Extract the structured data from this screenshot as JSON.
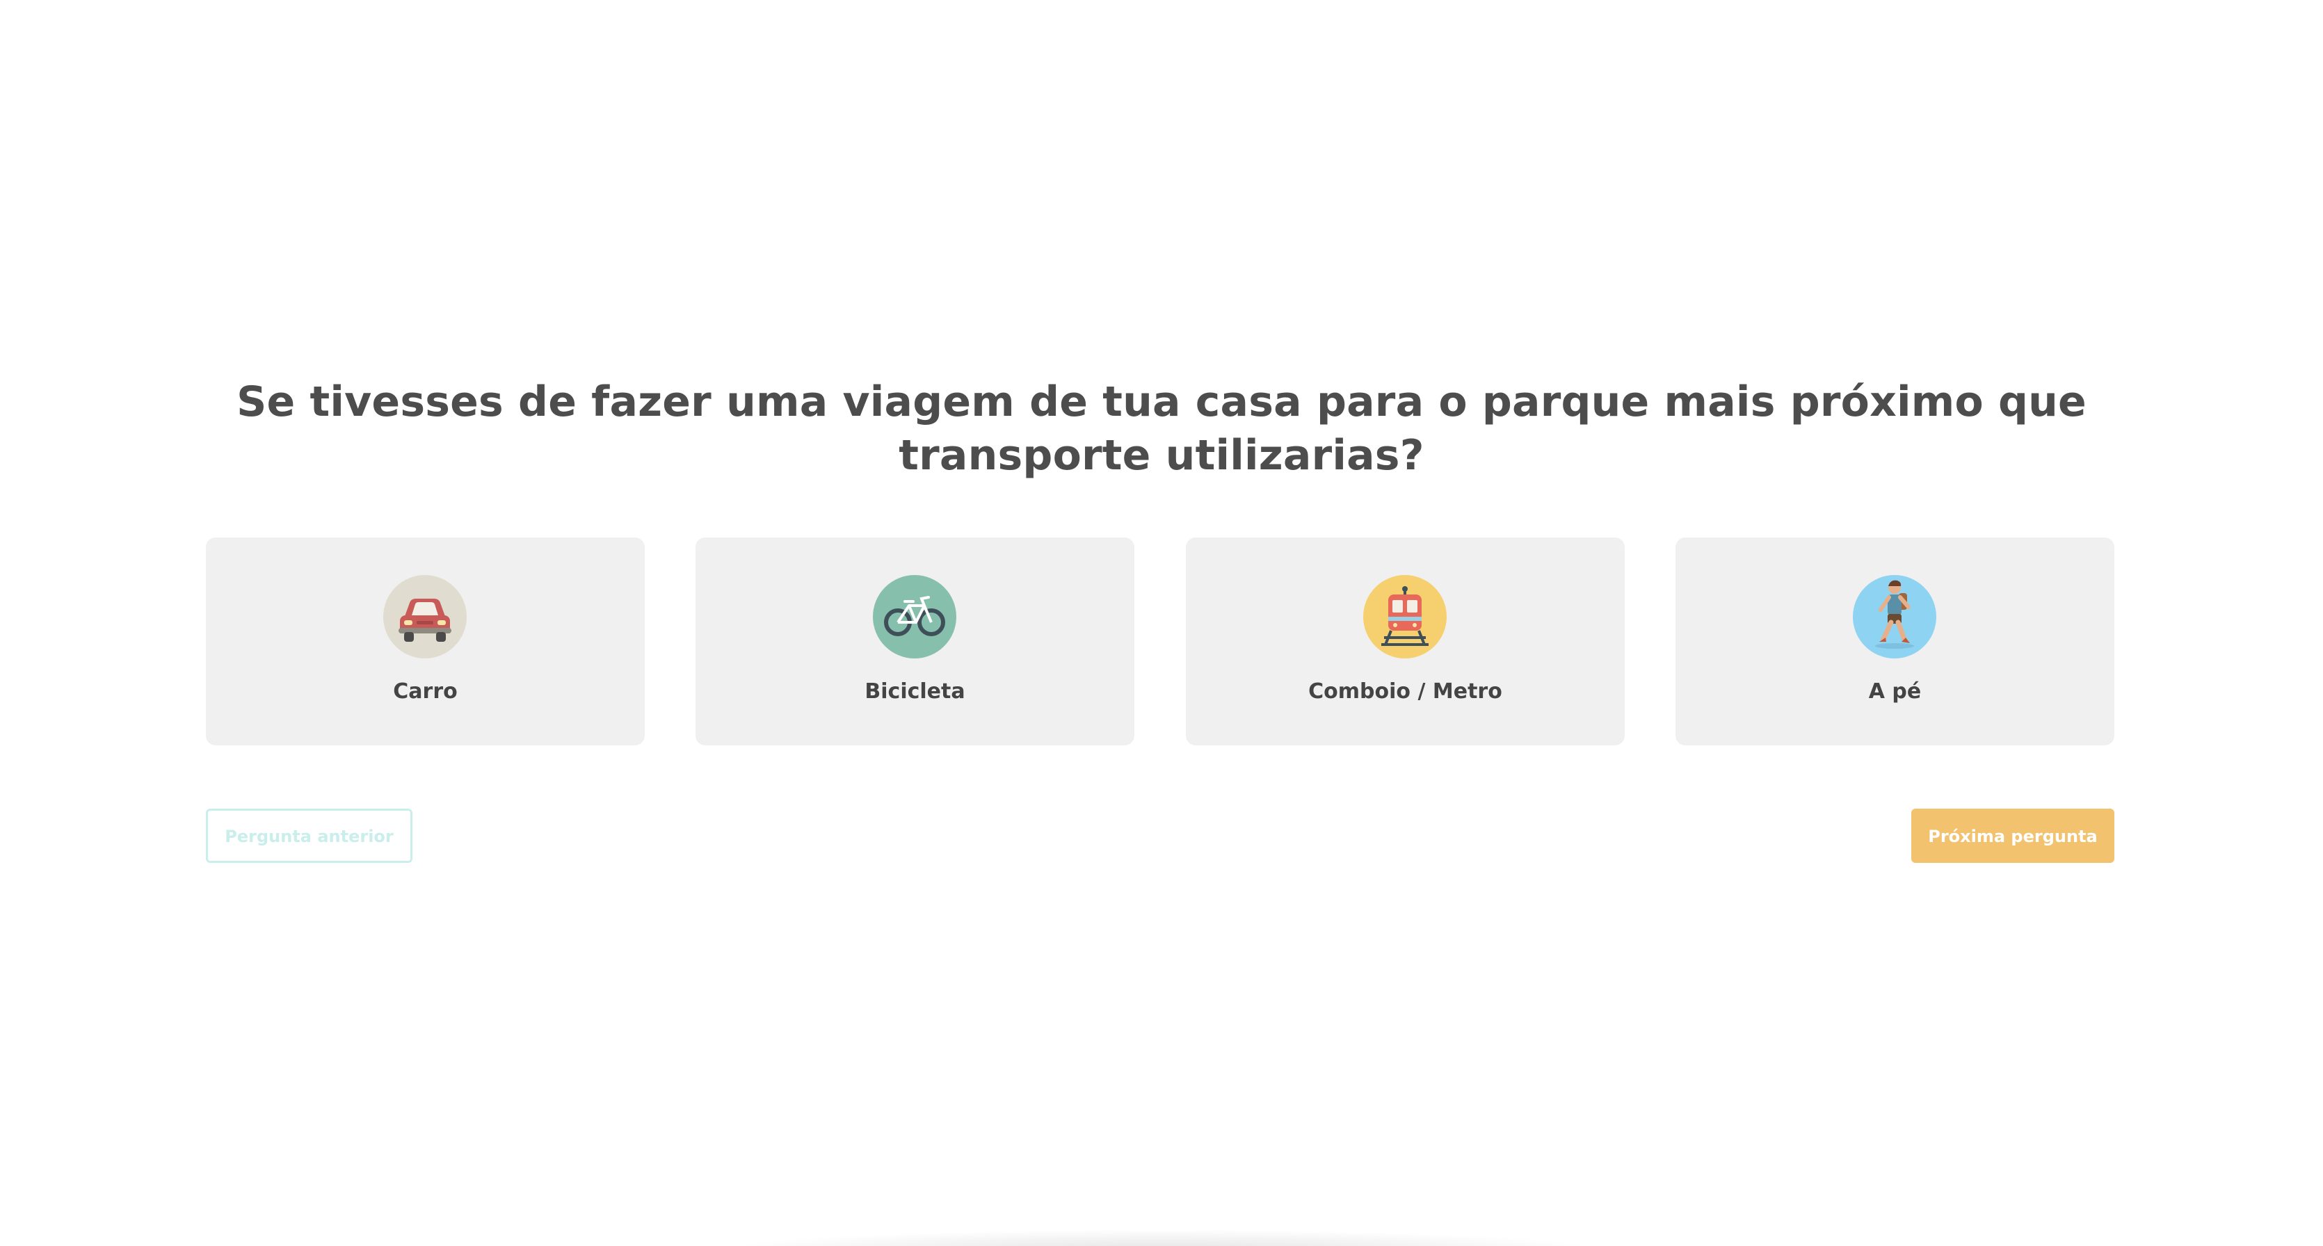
{
  "quiz": {
    "question": "Se tivesses de fazer uma viagem de tua casa para o parque mais próximo que transporte utilizarias?",
    "options": [
      {
        "label": "Carro",
        "icon": "car-icon",
        "color": "#e0ddd0"
      },
      {
        "label": "Bicicleta",
        "icon": "bicycle-icon",
        "color": "#86c0ad"
      },
      {
        "label": "Comboio / Metro",
        "icon": "train-icon",
        "color": "#f6cf6e"
      },
      {
        "label": "A pé",
        "icon": "walking-person-icon",
        "color": "#8fd3f2"
      }
    ],
    "previous_label": "Pergunta anterior",
    "next_label": "Próxima pergunta"
  },
  "colors": {
    "text": "#4d4d4d",
    "card_background": "#f0f0f0",
    "previous_border": "#c9eeec",
    "next_background": "#f2c26e"
  }
}
